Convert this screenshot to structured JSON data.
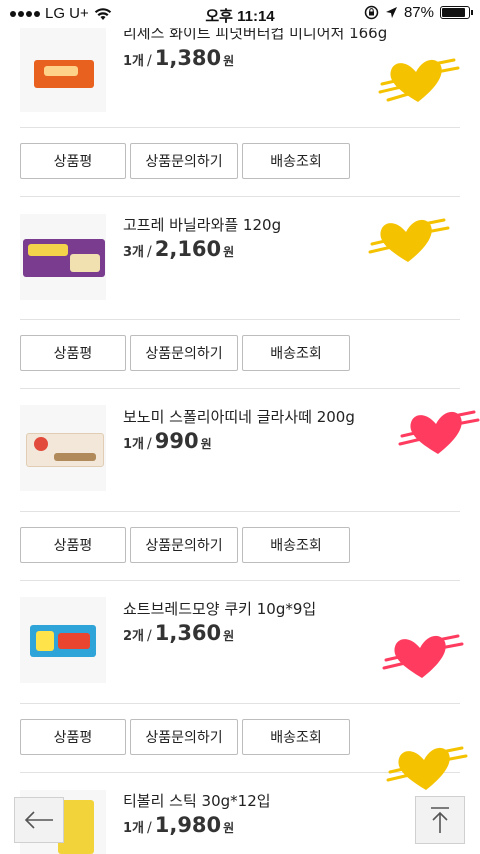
{
  "status": {
    "carrier": "LG U+",
    "time": "오후 11:14",
    "battery": "87%",
    "battery_level": 0.87
  },
  "items": [
    {
      "name": "리세스 화이트 피넛버터컵 미니어처 166g",
      "qty": "1개",
      "price": "1,380",
      "won": "원",
      "heart_color": "#f5c200"
    },
    {
      "name": "고프레 바닐라와플 120g",
      "qty": "3개",
      "price": "2,160",
      "won": "원",
      "heart_color": "#f5c200"
    },
    {
      "name": "보노미 스폴리아띠네 글라사떼 200g",
      "qty": "1개",
      "price": "990",
      "won": "원",
      "heart_color": "#ff3c5f"
    },
    {
      "name": "쇼트브레드모양 쿠키 10g*9입",
      "qty": "2개",
      "price": "1,360",
      "won": "원",
      "heart_color": "#ff3c5f"
    },
    {
      "name": "티볼리 스틱 30g*12입",
      "qty": "1개",
      "price": "1,980",
      "won": "원",
      "heart_color": "#f5c200"
    }
  ],
  "buttons": {
    "review": "상품평",
    "inquiry": "상품문의하기",
    "delivery": "배송조회"
  },
  "colors": {
    "yellow_heart": "#f5c200",
    "red_heart": "#ff3c5f"
  }
}
